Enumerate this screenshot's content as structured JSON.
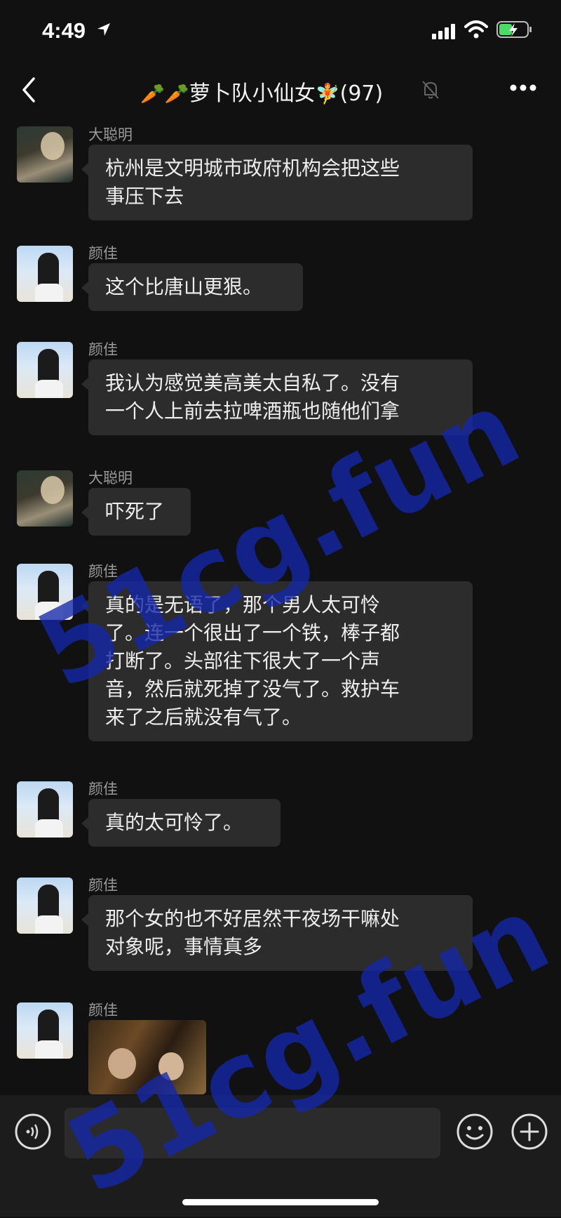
{
  "status_bar": {
    "time": "4:49"
  },
  "header": {
    "title": "萝卜队小仙女",
    "title_emoji_left": "🥕🥕",
    "title_emoji_right": "🧚",
    "member_count": "(97)"
  },
  "messages": [
    {
      "sender": "大聪明",
      "avatar": "cat-photo",
      "text_lines": [
        "杭州是文明城市政府机构会把这些",
        "事压下去"
      ]
    },
    {
      "sender": "颜佳",
      "avatar": "girl-beach-photo",
      "text_lines": [
        "这个比唐山更狠。"
      ]
    },
    {
      "sender": "颜佳",
      "avatar": "girl-beach-photo",
      "text_lines": [
        "我认为感觉美高美太自私了。没有",
        "一个人上前去拉啤酒瓶也随他们拿"
      ]
    },
    {
      "sender": "大聪明",
      "avatar": "cat-photo",
      "text_lines": [
        "吓死了"
      ]
    },
    {
      "sender": "颜佳",
      "avatar": "girl-beach-photo",
      "text_lines": [
        "真的是无语了，那个男人太可怜",
        "了。连一个很出了一个铁，棒子都",
        "打断了。头部往下很大了一个声",
        "音，然后就死掉了没气了。救护车",
        "来了之后就没有气了。"
      ]
    },
    {
      "sender": "颜佳",
      "avatar": "girl-beach-photo",
      "text_lines": [
        "真的太可怜了。"
      ]
    },
    {
      "sender": "颜佳",
      "avatar": "girl-beach-photo",
      "text_lines": [
        "那个女的也不好居然干夜场干嘛处",
        "对象呢，事情真多"
      ]
    },
    {
      "sender": "颜佳",
      "avatar": "girl-beach-photo",
      "image": "photo-thumbnail"
    }
  ],
  "watermark": "51cg.fun",
  "colors": {
    "background": "#111111",
    "bubble": "#2c2c2c",
    "watermark": "#1428aa"
  }
}
